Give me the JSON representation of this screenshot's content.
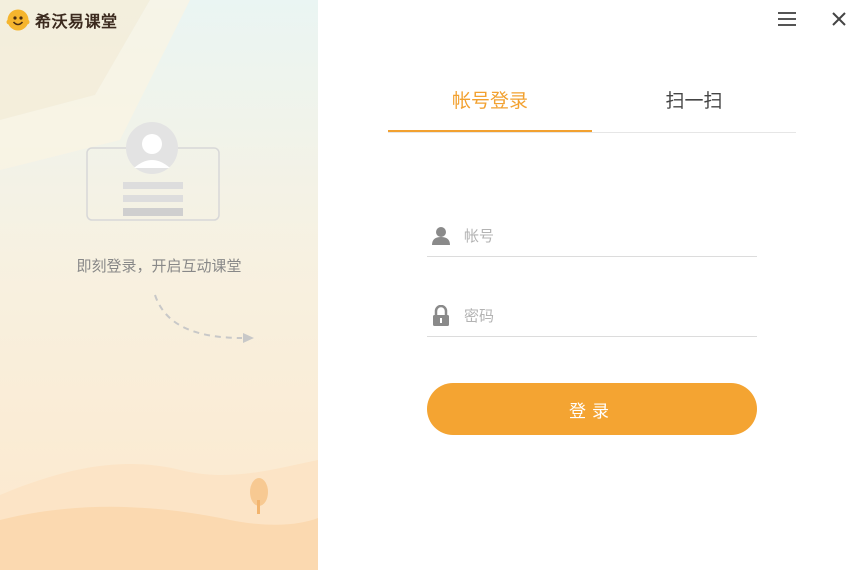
{
  "app": {
    "title": "希沃易课堂"
  },
  "left_panel": {
    "slogan": "即刻登录，开启互动课堂"
  },
  "window_controls": {
    "menu_icon": "menu-icon",
    "close_icon": "close-icon"
  },
  "tabs": [
    {
      "label": "帐号登录",
      "active": true
    },
    {
      "label": "扫一扫",
      "active": false
    }
  ],
  "form": {
    "account": {
      "placeholder": "帐号",
      "value": "",
      "icon": "user-icon"
    },
    "password": {
      "placeholder": "密码",
      "value": "",
      "icon": "lock-icon"
    },
    "submit_label": "登录"
  },
  "colors": {
    "accent": "#f4a432",
    "tab_active": "#f2a130",
    "text_dark": "#444444"
  }
}
